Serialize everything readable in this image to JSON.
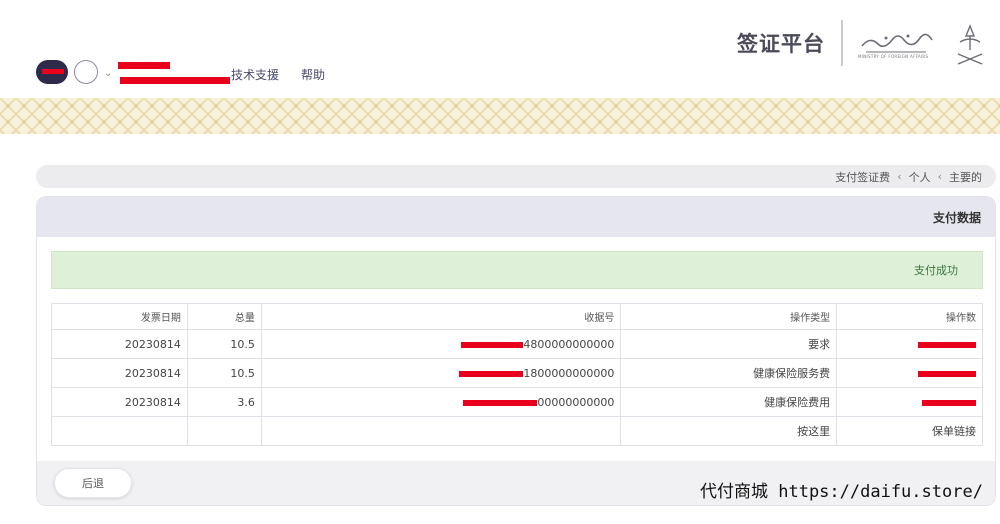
{
  "header": {
    "nav_support": "技术支援",
    "nav_help": "帮助",
    "platform_title": "签证平台",
    "ministry_text": "MINISTRY OF FOREIGN AFFAIRS"
  },
  "breadcrumb": {
    "items": [
      "支付签证费",
      "个人",
      "主要的"
    ],
    "separator": "‹"
  },
  "panel": {
    "title": "支付数据",
    "alert_text": "支付成功",
    "table": {
      "headers": [
        "发票日期",
        "总量",
        "收据号",
        "操作类型",
        "操作数"
      ],
      "rows": [
        {
          "date": "20230814",
          "total": "10.5",
          "receipt_suffix": "4800000000000",
          "type": "要求"
        },
        {
          "date": "20230814",
          "total": "10.5",
          "receipt_suffix": "1800000000000",
          "type": "健康保险服务费"
        },
        {
          "date": "20230814",
          "total": "3.6",
          "receipt_suffix": "00000000000",
          "type": "健康保险费用"
        }
      ],
      "footer_row": {
        "click_here": "按这里",
        "policy_link": "保单链接"
      }
    },
    "back_button": "后退"
  },
  "watermark": "代付商城 https://daifu.store/",
  "colors": {
    "redaction": "#e8001c",
    "alert_bg": "#dff0d8",
    "alert_text": "#3c763d",
    "header_bg": "#e6e6f0"
  }
}
